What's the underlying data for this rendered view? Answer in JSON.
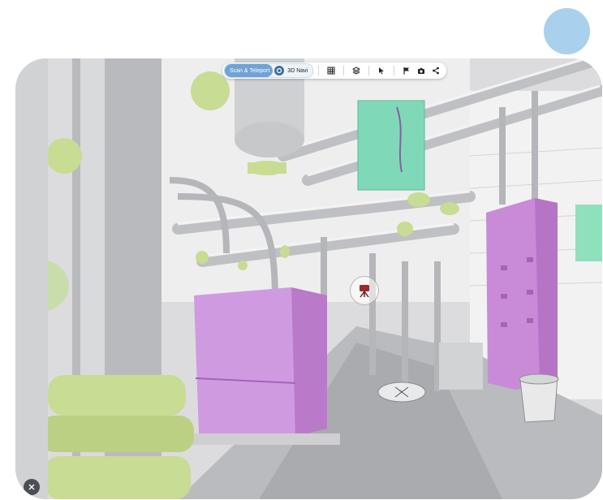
{
  "toolbar": {
    "mode_active_label": "Scan & Teleport",
    "mode_inactive_label": "3D Navi",
    "tools": [
      {
        "name": "grid-icon"
      },
      {
        "name": "layers-icon"
      },
      {
        "name": "pointer-icon"
      },
      {
        "name": "flag-icon"
      },
      {
        "name": "camera-icon"
      },
      {
        "name": "share-icon"
      }
    ]
  },
  "colors": {
    "accent": "#6fa3d6",
    "corner_circle": "#a9d0ec",
    "magenta_equipment": "#c98ad8",
    "teal_box": "#7fd9b8",
    "flange_green": "#c8dc93"
  },
  "icons": {
    "close": "close-icon",
    "scan_position": "scan-position-marker-icon",
    "floor_cursor": "floor-target-cursor-icon"
  }
}
